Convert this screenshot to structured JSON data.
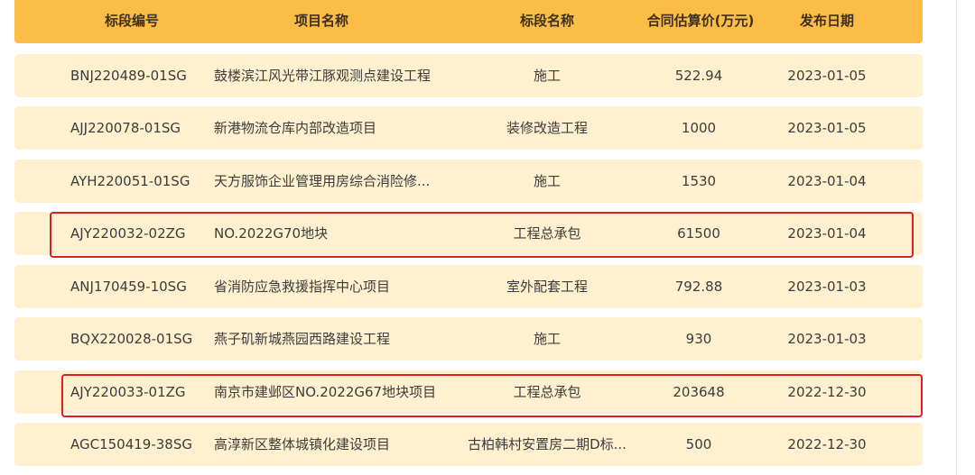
{
  "table": {
    "headers": {
      "code": "标段编号",
      "project": "项目名称",
      "section": "标段名称",
      "price": "合同估算价(万元)",
      "date": "发布日期"
    },
    "rows": [
      {
        "code": "BNJ220489-01SG",
        "project": "鼓楼滨江风光带江豚观测点建设工程",
        "section": "施工",
        "price": "522.94",
        "date": "2023-01-05",
        "highlighted": false
      },
      {
        "code": "AJJ220078-01SG",
        "project": "新港物流仓库内部改造项目",
        "section": "装修改造工程",
        "price": "1000",
        "date": "2023-01-05",
        "highlighted": false
      },
      {
        "code": "AYH220051-01SG",
        "project": "天方服饰企业管理用房综合消险修...",
        "section": "施工",
        "price": "1530",
        "date": "2023-01-04",
        "highlighted": false
      },
      {
        "code": "AJY220032-02ZG",
        "project": "NO.2022G70地块",
        "section": "工程总承包",
        "price": "61500",
        "date": "2023-01-04",
        "highlighted": true
      },
      {
        "code": "ANJ170459-10SG",
        "project": "省消防应急救援指挥中心项目",
        "section": "室外配套工程",
        "price": "792.88",
        "date": "2023-01-03",
        "highlighted": false
      },
      {
        "code": "BQX220028-01SG",
        "project": "燕子矶新城燕园西路建设工程",
        "section": "施工",
        "price": "930",
        "date": "2023-01-03",
        "highlighted": false
      },
      {
        "code": "AJY220033-01ZG",
        "project": "南京市建邺区NO.2022G67地块项目",
        "section": "工程总承包",
        "price": "203648",
        "date": "2022-12-30",
        "highlighted": true
      },
      {
        "code": "AGC150419-38SG",
        "project": "高淳新区整体城镇化建设项目",
        "section": "古柏韩村安置房二期D标...",
        "price": "500",
        "date": "2022-12-30",
        "highlighted": false
      }
    ]
  },
  "colors": {
    "header_bg": "#fbbd45",
    "row_bg": "#fff1cf",
    "highlight_border": "#e02020"
  }
}
